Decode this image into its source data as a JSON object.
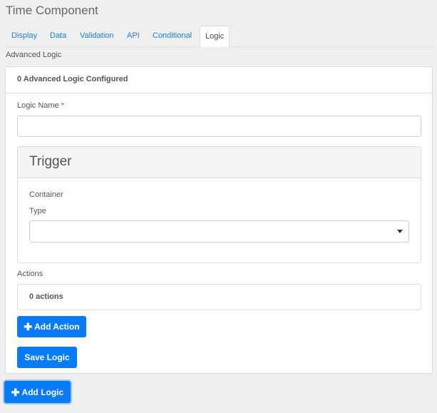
{
  "title": "Time Component",
  "tabs": [
    {
      "label": "Display",
      "active": false
    },
    {
      "label": "Data",
      "active": false
    },
    {
      "label": "Validation",
      "active": false
    },
    {
      "label": "API",
      "active": false
    },
    {
      "label": "Conditional",
      "active": false
    },
    {
      "label": "Logic",
      "active": true
    }
  ],
  "section_label": "Advanced Logic",
  "panel": {
    "header": "0 Advanced Logic Configured",
    "logic_name_label": "Logic Name",
    "required_mark": "*",
    "logic_name_value": "",
    "trigger": {
      "title": "Trigger",
      "container_label": "Container",
      "type_label": "Type",
      "type_value": ""
    },
    "actions_label": "Actions",
    "actions_count": "0 actions",
    "add_action_label": "Add Action",
    "save_logic_label": "Save Logic"
  },
  "add_logic_label": "Add Logic",
  "colors": {
    "primary": "#0a7bf6",
    "tab_link": "#1a7fd6",
    "required": "#e53935"
  }
}
